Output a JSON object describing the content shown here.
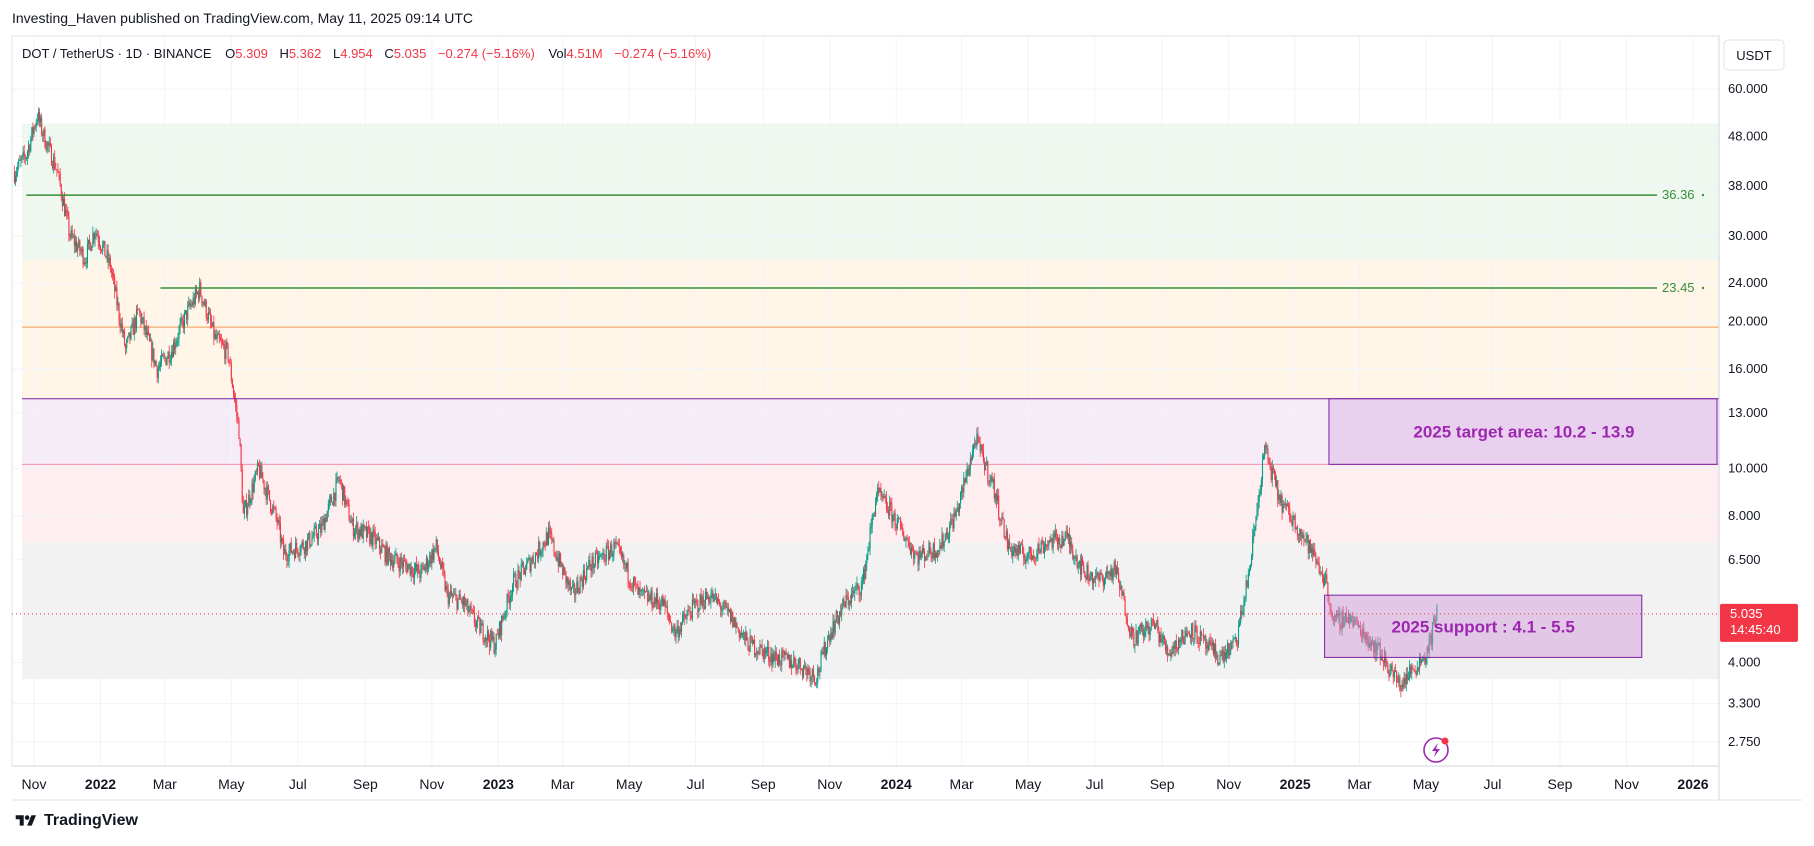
{
  "header": {
    "published_by": "Investing_Haven published on TradingView.com, May 11, 2025 09:14 UTC"
  },
  "legend": {
    "symbol": "DOT / TetherUS · 1D · BINANCE",
    "o_label": "O",
    "o_value": "5.309",
    "h_label": "H",
    "h_value": "5.362",
    "l_label": "L",
    "l_value": "4.954",
    "c_label": "C",
    "c_value": "5.035",
    "change": "−0.274 (−5.16%)",
    "vol_label": "Vol",
    "vol_value": "4.51M",
    "vol_change": "−0.274 (−5.16%)"
  },
  "currency": "USDT",
  "footer": {
    "brand": "TradingView"
  },
  "colors": {
    "up": "#089981",
    "down": "#f23645",
    "green_line": "#388e3c",
    "zone_green": "#e8f5e9",
    "zone_orange": "#fff3e0",
    "zone_purple": "#f3e5f5",
    "zone_pink": "#fde8ea",
    "zone_gray": "#eeeeee",
    "annot_purple": "#9c27b0",
    "price_label_bg": "#f23645"
  },
  "chart_data": {
    "type": "candlestick",
    "title": "DOT / TetherUS · 1D · BINANCE",
    "y_scale": "log",
    "y_ticks": [
      "60.000",
      "48.000",
      "38.000",
      "30.000",
      "24.000",
      "20.000",
      "16.000",
      "13.000",
      "10.000",
      "8.000",
      "6.500",
      "4.000",
      "3.300",
      "2.750"
    ],
    "y_tick_values": [
      60,
      48,
      38,
      30,
      24,
      20,
      16,
      13,
      10,
      8,
      6.5,
      4,
      3.3,
      2.75
    ],
    "ylim": [
      2.45,
      75
    ],
    "x_ticks": [
      {
        "label": "Nov",
        "date": "2021-11-01",
        "bold": false
      },
      {
        "label": "2022",
        "date": "2022-01-01",
        "bold": true
      },
      {
        "label": "Mar",
        "date": "2022-03-01",
        "bold": false
      },
      {
        "label": "May",
        "date": "2022-05-01",
        "bold": false
      },
      {
        "label": "Jul",
        "date": "2022-07-01",
        "bold": false
      },
      {
        "label": "Sep",
        "date": "2022-09-01",
        "bold": false
      },
      {
        "label": "Nov",
        "date": "2022-11-01",
        "bold": false
      },
      {
        "label": "2023",
        "date": "2023-01-01",
        "bold": true
      },
      {
        "label": "Mar",
        "date": "2023-03-01",
        "bold": false
      },
      {
        "label": "May",
        "date": "2023-05-01",
        "bold": false
      },
      {
        "label": "Jul",
        "date": "2023-07-01",
        "bold": false
      },
      {
        "label": "Sep",
        "date": "2023-09-01",
        "bold": false
      },
      {
        "label": "Nov",
        "date": "2023-11-01",
        "bold": false
      },
      {
        "label": "2024",
        "date": "2024-01-01",
        "bold": true
      },
      {
        "label": "Mar",
        "date": "2024-03-01",
        "bold": false
      },
      {
        "label": "May",
        "date": "2024-05-01",
        "bold": false
      },
      {
        "label": "Jul",
        "date": "2024-07-01",
        "bold": false
      },
      {
        "label": "Sep",
        "date": "2024-09-01",
        "bold": false
      },
      {
        "label": "Nov",
        "date": "2024-11-01",
        "bold": false
      },
      {
        "label": "2025",
        "date": "2025-01-01",
        "bold": true
      },
      {
        "label": "Mar",
        "date": "2025-03-01",
        "bold": false
      },
      {
        "label": "May",
        "date": "2025-05-01",
        "bold": false
      },
      {
        "label": "Jul",
        "date": "2025-07-01",
        "bold": false
      },
      {
        "label": "Sep",
        "date": "2025-09-01",
        "bold": false
      },
      {
        "label": "Nov",
        "date": "2025-11-01",
        "bold": false
      },
      {
        "label": "2026",
        "date": "2026-01-01",
        "bold": true
      }
    ],
    "price_path": [
      [
        "2021-10-14",
        40.5
      ],
      [
        "2021-10-25",
        44
      ],
      [
        "2021-11-04",
        53
      ],
      [
        "2021-11-10",
        48
      ],
      [
        "2021-11-22",
        41
      ],
      [
        "2021-12-04",
        30
      ],
      [
        "2021-12-18",
        27
      ],
      [
        "2021-12-27",
        31
      ],
      [
        "2022-01-10",
        26
      ],
      [
        "2022-01-24",
        17.5
      ],
      [
        "2022-02-05",
        21
      ],
      [
        "2022-02-22",
        16
      ],
      [
        "2022-03-07",
        17.5
      ],
      [
        "2022-03-22",
        21
      ],
      [
        "2022-04-02",
        23.3
      ],
      [
        "2022-04-16",
        18.5
      ],
      [
        "2022-04-28",
        17.2
      ],
      [
        "2022-05-08",
        12
      ],
      [
        "2022-05-12",
        8
      ],
      [
        "2022-05-26",
        10
      ],
      [
        "2022-06-12",
        7.8
      ],
      [
        "2022-06-18",
        6.7
      ],
      [
        "2022-07-08",
        7
      ],
      [
        "2022-07-22",
        7.5
      ],
      [
        "2022-08-08",
        9.5
      ],
      [
        "2022-08-20",
        7.6
      ],
      [
        "2022-09-08",
        7.2
      ],
      [
        "2022-09-22",
        6.6
      ],
      [
        "2022-10-10",
        6.3
      ],
      [
        "2022-10-22",
        6.1
      ],
      [
        "2022-11-05",
        6.9
      ],
      [
        "2022-11-15",
        5.5
      ],
      [
        "2022-11-30",
        5.3
      ],
      [
        "2022-12-12",
        4.8
      ],
      [
        "2022-12-29",
        4.35
      ],
      [
        "2023-01-14",
        5.8
      ],
      [
        "2023-02-03",
        6.6
      ],
      [
        "2023-02-16",
        7.3
      ],
      [
        "2023-03-10",
        5.5
      ],
      [
        "2023-03-25",
        6.3
      ],
      [
        "2023-04-18",
        6.9
      ],
      [
        "2023-05-10",
        5.5
      ],
      [
        "2023-06-01",
        5.3
      ],
      [
        "2023-06-12",
        4.6
      ],
      [
        "2023-06-29",
        5.2
      ],
      [
        "2023-07-14",
        5.5
      ],
      [
        "2023-08-01",
        5
      ],
      [
        "2023-08-17",
        4.4
      ],
      [
        "2023-09-12",
        4.1
      ],
      [
        "2023-10-01",
        4
      ],
      [
        "2023-10-20",
        3.75
      ],
      [
        "2023-11-01",
        4.6
      ],
      [
        "2023-11-15",
        5.3
      ],
      [
        "2023-12-01",
        5.8
      ],
      [
        "2023-12-14",
        8.9
      ],
      [
        "2023-12-26",
        8.2
      ],
      [
        "2024-01-20",
        6.6
      ],
      [
        "2024-02-10",
        6.9
      ],
      [
        "2024-02-26",
        8.2
      ],
      [
        "2024-03-14",
        11.5
      ],
      [
        "2024-03-30",
        9.2
      ],
      [
        "2024-04-13",
        6.9
      ],
      [
        "2024-05-01",
        6.6
      ],
      [
        "2024-05-20",
        7.1
      ],
      [
        "2024-06-06",
        7.2
      ],
      [
        "2024-06-20",
        6.2
      ],
      [
        "2024-07-04",
        5.9
      ],
      [
        "2024-07-20",
        6.2
      ],
      [
        "2024-08-05",
        4.5
      ],
      [
        "2024-08-25",
        4.8
      ],
      [
        "2024-09-06",
        4.2
      ],
      [
        "2024-09-28",
        4.7
      ],
      [
        "2024-10-12",
        4.3
      ],
      [
        "2024-10-25",
        4.1
      ],
      [
        "2024-11-08",
        4.4
      ],
      [
        "2024-11-20",
        6.2
      ],
      [
        "2024-12-04",
        11
      ],
      [
        "2024-12-18",
        8.6
      ],
      [
        "2025-01-05",
        7.5
      ],
      [
        "2025-01-20",
        6.5
      ],
      [
        "2025-01-30",
        5.8
      ],
      [
        "2025-02-05",
        4.8
      ],
      [
        "2025-02-18",
        5
      ],
      [
        "2025-03-05",
        4.6
      ],
      [
        "2025-03-20",
        4.2
      ],
      [
        "2025-04-07",
        3.6
      ],
      [
        "2025-04-20",
        3.9
      ],
      [
        "2025-05-02",
        4.2
      ],
      [
        "2025-05-11",
        5.035
      ]
    ],
    "horizontal_lines": [
      {
        "label": "36.36",
        "value": 36.36,
        "start": "2021-10-25"
      },
      {
        "label": "23.45",
        "value": 23.45,
        "start": "2022-02-25"
      }
    ],
    "fib_zones": [
      {
        "name": "green",
        "top": 51,
        "bottom": 26.8
      },
      {
        "name": "orange",
        "top": 26.8,
        "bottom": 13.9
      },
      {
        "name": "purple",
        "top": 13.9,
        "bottom": 10.2
      },
      {
        "name": "pink",
        "top": 10.2,
        "bottom": 7.05
      },
      {
        "name": "gray",
        "top": 7.05,
        "bottom": 3.7
      }
    ],
    "fib_lines": [
      {
        "value": 19.5,
        "color": "#ef9a59"
      },
      {
        "value": 10.2,
        "color": "#f48fb1"
      }
    ],
    "annotations": [
      {
        "text": "2025 target area: 10.2 - 13.9",
        "top": 13.9,
        "bottom": 10.2,
        "start": "2025-02-01"
      },
      {
        "text": "2025 support : 4.1 - 5.5",
        "top": 5.5,
        "bottom": 4.1,
        "start": "2025-01-28",
        "end": "2025-11-15"
      }
    ],
    "last_price": {
      "value": 5.035,
      "label": "5.035",
      "countdown": "14:45:40"
    }
  }
}
